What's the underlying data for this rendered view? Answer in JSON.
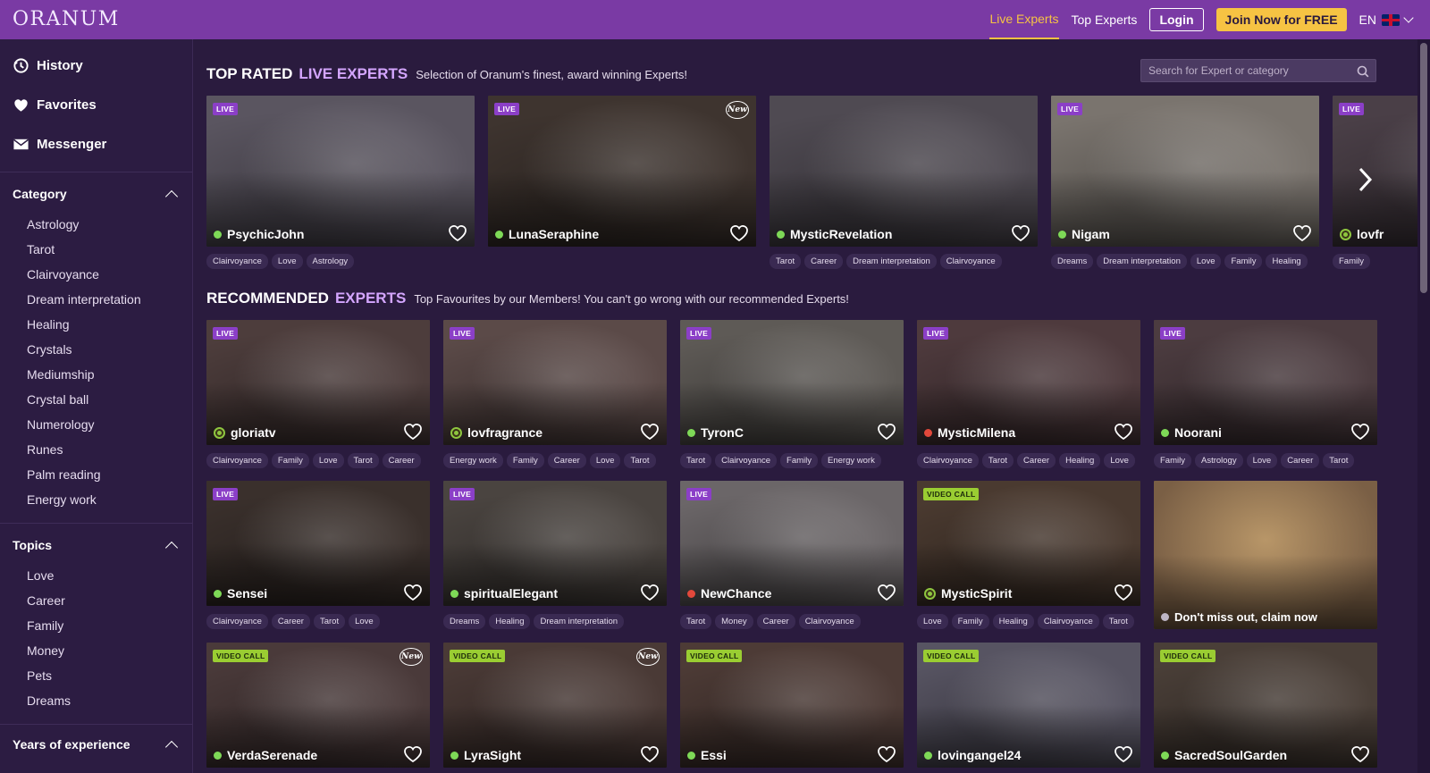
{
  "app": {
    "logo": "ORANUM"
  },
  "nav": {
    "live": "Live Experts",
    "top": "Top Experts",
    "login": "Login",
    "join": "Join Now for FREE",
    "lang": "EN"
  },
  "sidebar": {
    "top_items": [
      {
        "label": "History",
        "icon": "history-icon"
      },
      {
        "label": "Favorites",
        "icon": "heart-icon"
      },
      {
        "label": "Messenger",
        "icon": "envelope-icon"
      }
    ],
    "category": {
      "title": "Category",
      "items": [
        "Astrology",
        "Tarot",
        "Clairvoyance",
        "Dream interpretation",
        "Healing",
        "Crystals",
        "Mediumship",
        "Crystal ball",
        "Numerology",
        "Runes",
        "Palm reading",
        "Energy work"
      ]
    },
    "topics": {
      "title": "Topics",
      "items": [
        "Love",
        "Career",
        "Family",
        "Money",
        "Pets",
        "Dreams"
      ]
    },
    "years": {
      "title": "Years of experience"
    }
  },
  "search": {
    "placeholder": "Search for Expert or category"
  },
  "top_rated": {
    "t1": "TOP RATED",
    "t2": "LIVE EXPERTS",
    "sub": "Selection of Oranum's finest, award winning Experts!",
    "experts": [
      {
        "name": "PsychicJohn",
        "badge": "LIVE",
        "status": "online",
        "tags": [
          "Clairvoyance",
          "Love",
          "Astrology"
        ],
        "bg": "#5a5560"
      },
      {
        "name": "LunaSeraphine",
        "badge": "LIVE",
        "new": "New",
        "status": "online",
        "tags": [],
        "bg": "#3e342f"
      },
      {
        "name": "MysticRevelation",
        "badge": "",
        "status": "online",
        "tags": [
          "Tarot",
          "Career",
          "Dream interpretation",
          "Clairvoyance"
        ],
        "bg": "#4f4a52"
      },
      {
        "name": "Nigam",
        "badge": "LIVE",
        "status": "online",
        "tags": [
          "Dreams",
          "Dream interpretation",
          "Love",
          "Family",
          "Healing"
        ],
        "bg": "#7a746e"
      },
      {
        "name": "lovfr",
        "badge": "LIVE",
        "status": "ring",
        "tags": [
          "Family"
        ],
        "bg": "#4a3f47"
      }
    ]
  },
  "recommended": {
    "t1": "RECOMMENDED",
    "t2": "EXPERTS",
    "sub": "Top Favourites by our Members! You can't go wrong with our recommended Experts!",
    "rows": [
      [
        {
          "name": "gloriatv",
          "badge": "LIVE",
          "status": "ring",
          "tags": [
            "Clairvoyance",
            "Family",
            "Love",
            "Tarot",
            "Career"
          ],
          "bg": "#4d3d3c"
        },
        {
          "name": "lovfragrance",
          "badge": "LIVE",
          "status": "ring",
          "tags": [
            "Energy work",
            "Family",
            "Career",
            "Love",
            "Tarot"
          ],
          "bg": "#5b4a48"
        },
        {
          "name": "TyronC",
          "badge": "LIVE",
          "status": "online",
          "tags": [
            "Tarot",
            "Clairvoyance",
            "Family",
            "Energy work"
          ],
          "bg": "#5e5a56"
        },
        {
          "name": "MysticMilena",
          "badge": "LIVE",
          "status": "busy",
          "tags": [
            "Clairvoyance",
            "Tarot",
            "Career",
            "Healing",
            "Love"
          ],
          "bg": "#4e3a3d"
        },
        {
          "name": "Noorani",
          "badge": "LIVE",
          "status": "online",
          "tags": [
            "Family",
            "Astrology",
            "Love",
            "Career",
            "Tarot"
          ],
          "bg": "#4c3c40"
        }
      ],
      [
        {
          "name": "Sensei",
          "badge": "LIVE",
          "status": "online",
          "tags": [
            "Clairvoyance",
            "Career",
            "Tarot",
            "Love"
          ],
          "bg": "#3a302c"
        },
        {
          "name": "spiritualElegant",
          "badge": "LIVE",
          "status": "online",
          "tags": [
            "Dreams",
            "Healing",
            "Dream interpretation"
          ],
          "bg": "#4a4440"
        },
        {
          "name": "NewChance",
          "badge": "LIVE",
          "status": "busy",
          "tags": [
            "Tarot",
            "Money",
            "Career",
            "Clairvoyance"
          ],
          "bg": "#6b6668"
        },
        {
          "name": "MysticSpirit",
          "badge": "VIDEO CALL",
          "status": "ring",
          "tags": [
            "Love",
            "Family",
            "Healing",
            "Clairvoyance",
            "Tarot"
          ],
          "bg": "#4a3a30"
        },
        {
          "name": "Don't miss out, claim now",
          "badge": "",
          "status": "grey",
          "tags": [],
          "bg": "#8a6e4e",
          "promo": true
        }
      ],
      [
        {
          "name": "VerdaSerenade",
          "badge": "VIDEO CALL",
          "new": "New",
          "status": "online",
          "tags": [],
          "bg": "#4a3a3a"
        },
        {
          "name": "LyraSight",
          "badge": "VIDEO CALL",
          "new": "New",
          "status": "online",
          "tags": [],
          "bg": "#4a3a36"
        },
        {
          "name": "Essi",
          "badge": "VIDEO CALL",
          "status": "online",
          "tags": [],
          "bg": "#4d3b36"
        },
        {
          "name": "lovingangel24",
          "badge": "VIDEO CALL",
          "status": "online",
          "tags": [],
          "bg": "#575462"
        },
        {
          "name": "SacredSoulGarden",
          "badge": "VIDEO CALL",
          "status": "online",
          "tags": [],
          "bg": "#4a3f38"
        }
      ]
    ]
  },
  "colors": {
    "topbar": "#7a3aa4",
    "accent": "#f6c343",
    "live_badge": "#8b3fc7",
    "video_badge": "#9acd32"
  }
}
